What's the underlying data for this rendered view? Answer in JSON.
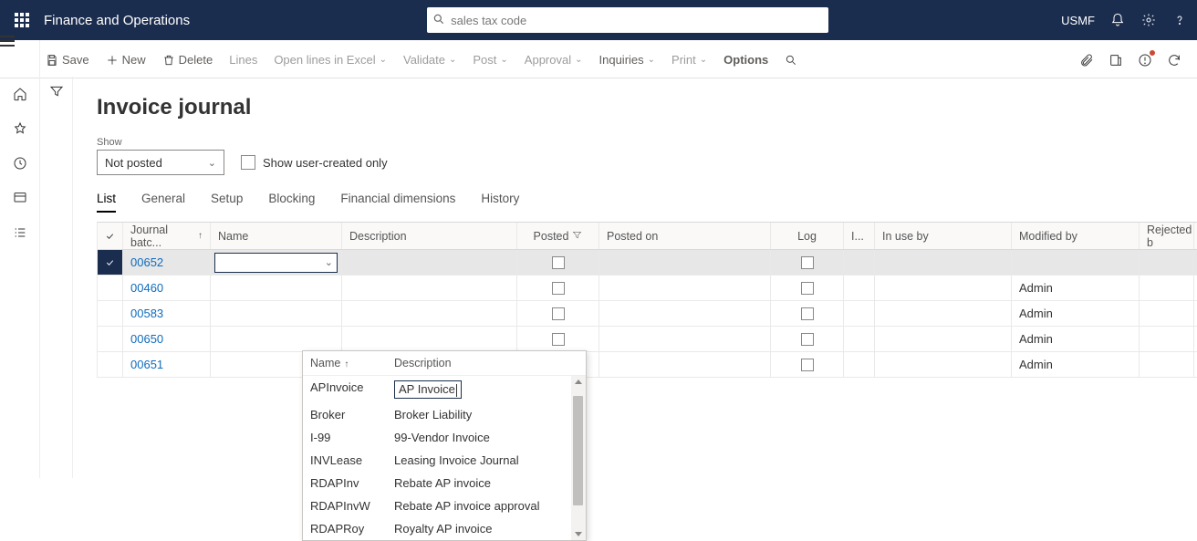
{
  "topbar": {
    "title": "Finance and Operations",
    "search_placeholder": "sales tax code",
    "company": "USMF"
  },
  "cmdbar": {
    "save": "Save",
    "new": "New",
    "delete": "Delete",
    "lines": "Lines",
    "open_lines": "Open lines in Excel",
    "validate": "Validate",
    "post": "Post",
    "approval": "Approval",
    "inquiries": "Inquiries",
    "print": "Print",
    "options": "Options"
  },
  "page": {
    "title": "Invoice journal",
    "show_label": "Show",
    "show_value": "Not posted",
    "user_created_only": "Show user-created only"
  },
  "tabs": [
    "List",
    "General",
    "Setup",
    "Blocking",
    "Financial dimensions",
    "History"
  ],
  "columns": {
    "batch": "Journal batc...",
    "name": "Name",
    "desc": "Description",
    "posted": "Posted",
    "posted_on": "Posted on",
    "log": "Log",
    "i": "I...",
    "in_use_by": "In use by",
    "modified_by": "Modified by",
    "rejected_by": "Rejected b"
  },
  "rows": [
    {
      "batch": "00652",
      "name": "",
      "desc": "",
      "modified_by": "",
      "selected": true,
      "editing_name": true
    },
    {
      "batch": "00460",
      "name": "",
      "desc": "",
      "modified_by": "Admin"
    },
    {
      "batch": "00583",
      "name": "",
      "desc": "",
      "modified_by": "Admin"
    },
    {
      "batch": "00650",
      "name": "",
      "desc": "",
      "modified_by": "Admin"
    },
    {
      "batch": "00651",
      "name": "",
      "desc": "",
      "modified_by": "Admin"
    }
  ],
  "lookup": {
    "head_name": "Name",
    "head_desc": "Description",
    "options": [
      {
        "name": "APInvoice",
        "desc": "AP Invoice",
        "selected": true
      },
      {
        "name": "Broker",
        "desc": "Broker Liability"
      },
      {
        "name": "I-99",
        "desc": "99-Vendor Invoice"
      },
      {
        "name": "INVLease",
        "desc": "Leasing Invoice Journal"
      },
      {
        "name": "RDAPInv",
        "desc": "Rebate AP invoice"
      },
      {
        "name": "RDAPInvW",
        "desc": "Rebate AP invoice approval"
      },
      {
        "name": "RDAPRoy",
        "desc": "Royalty AP invoice"
      }
    ]
  }
}
